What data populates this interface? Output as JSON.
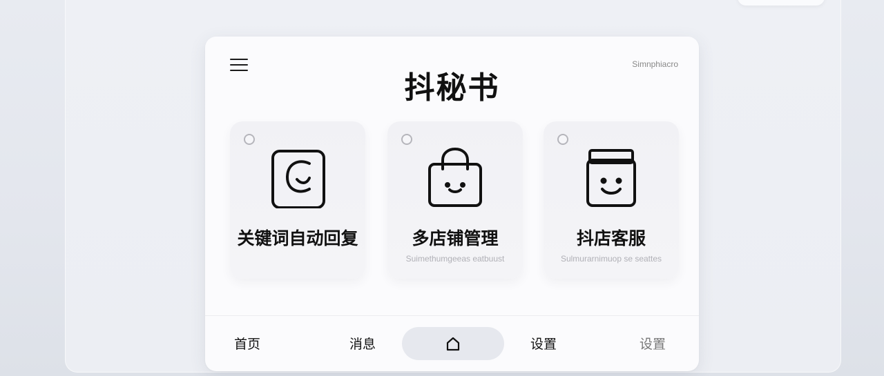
{
  "header": {
    "title": "抖秘书",
    "corner_label": "Simnphiacro",
    "menu_icon": "hamburger-menu-icon"
  },
  "features": [
    {
      "label": "关键词自动回复",
      "sublabel": "",
      "icon": "chat-bubble-icon"
    },
    {
      "label": "多店铺管理",
      "sublabel": "Suimethumgeeas eatbuust",
      "icon": "shopping-bag-icon"
    },
    {
      "label": "抖店客服",
      "sublabel": "Sulmurarnimuop se seattes",
      "icon": "support-face-icon"
    }
  ],
  "bottom_nav": {
    "items": [
      {
        "label": "首页"
      },
      {
        "label": "消息"
      },
      {
        "label": "设置"
      },
      {
        "label": "设置"
      }
    ],
    "center_icon": "home-icon"
  }
}
